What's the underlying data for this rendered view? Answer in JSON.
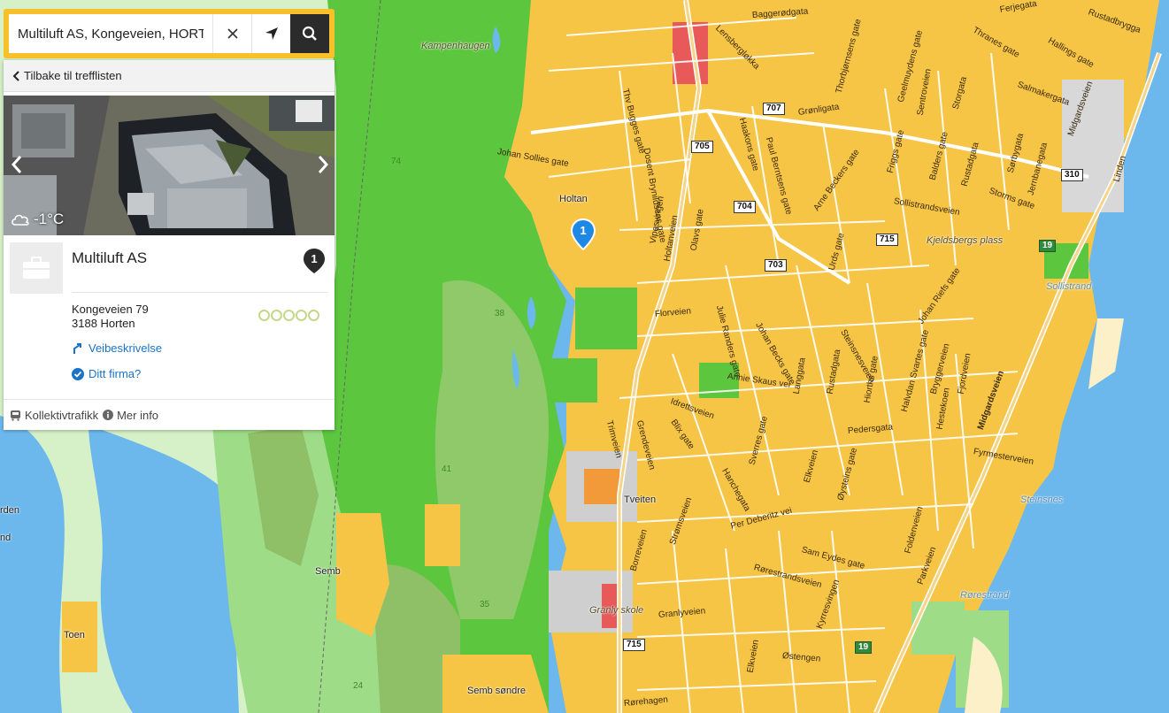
{
  "search": {
    "value": "Multiluft AS, Kongeveien, HORTEN",
    "placeholder": ""
  },
  "back_label": "Tilbake til trefflisten",
  "weather": {
    "temp": "-1°C",
    "icon": "cloud-icon"
  },
  "business": {
    "name": "Multiluft AS",
    "badge": "1",
    "street": "Kongeveien 79",
    "postal": "3188 Horten",
    "rating": 0,
    "directions_label": "Veibeskrivelse",
    "claim_label": "Ditt firma?"
  },
  "footer": {
    "transit_label": "Kollektivtrafikk",
    "info_label": "Mer info"
  },
  "map": {
    "marker_label": "1",
    "places": [
      "Kampenhaugen",
      "Holtan",
      "Tveiten",
      "Semb",
      "Toen",
      "Semb søndre",
      "Granly skole",
      "Kjeldsbergs plass",
      "Sollistrand",
      "Steinsnes",
      "Rørestrand",
      "rden",
      "nd"
    ],
    "streets": [
      "Baggerødgata",
      "Ferjegata",
      "Rustadbrygga",
      "Lensbergløkka",
      "Thranes gate",
      "Hallings gate",
      "Thorbjørnsens gate",
      "Geelmuydens gate",
      "Sentroveien",
      "Storgata",
      "Salmakergata",
      "Midgardsveien",
      "Grønligata",
      "Thv Bugges gate",
      "Haakons gate",
      "Paul Berntsens gate",
      "Arne Beckers gate",
      "Friggs gate",
      "Balders gate",
      "Rustadgata",
      "Sørbygata",
      "Jernbanegata",
      "Linden",
      "Johan Sollies gate",
      "Dosent Brynildsens gate",
      "Storms gate",
      "Sollistrandsveien",
      "Vipesvingen",
      "Holtanveien",
      "Olavs gate",
      "Urds gate",
      "Julie Randers gate",
      "Johan Becks gate",
      "Johan Riefs gate",
      "Florveien",
      "Steinsnesveien",
      "Annie Skaus vei",
      "Idrettsveien",
      "Langgata",
      "Rustadgata",
      "Hiorths gate",
      "Halvdan Svartes gate",
      "Bryggerveien",
      "Fjordveien",
      "Trimveien",
      "Grendeveien",
      "Blix gate",
      "Pedersgata",
      "Hestekoen",
      "Fyrmesterveien",
      "Elkveien",
      "Øysteins gate",
      "Sverres gate",
      "Hanchegata",
      "Per Deberitz vei",
      "Strømsveien",
      "Borreveien",
      "Sam Eydes gate",
      "Foldenveien",
      "Rørestrandsveien",
      "Parkveien",
      "Granlyveien",
      "Kyrresvingen",
      "Elkveien",
      "Østengen",
      "Rørehagen",
      "Midgardsveien"
    ],
    "road_numbers": [
      "707",
      "705",
      "704",
      "703",
      "715",
      "310",
      "19",
      "715",
      "19"
    ],
    "elevations": [
      "74",
      "38",
      "41",
      "35",
      "24"
    ]
  },
  "colors": {
    "accent": "#f6c12a",
    "link": "#1a73c7",
    "marker": "#1e88e5",
    "urban": "#f7c545",
    "forest": "#5cc63e",
    "water": "#6cb8ec"
  }
}
